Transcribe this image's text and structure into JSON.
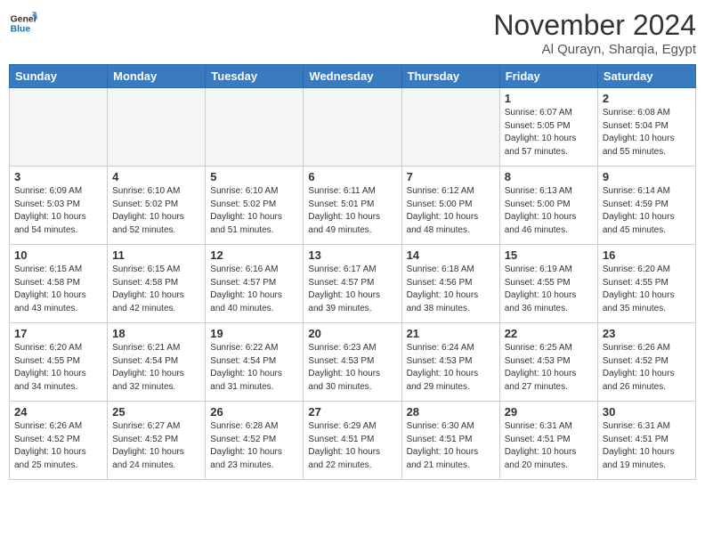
{
  "header": {
    "logo_line1": "General",
    "logo_line2": "Blue",
    "month": "November 2024",
    "location": "Al Qurayn, Sharqia, Egypt"
  },
  "weekdays": [
    "Sunday",
    "Monday",
    "Tuesday",
    "Wednesday",
    "Thursday",
    "Friday",
    "Saturday"
  ],
  "weeks": [
    [
      {
        "day": "",
        "info": ""
      },
      {
        "day": "",
        "info": ""
      },
      {
        "day": "",
        "info": ""
      },
      {
        "day": "",
        "info": ""
      },
      {
        "day": "",
        "info": ""
      },
      {
        "day": "1",
        "info": "Sunrise: 6:07 AM\nSunset: 5:05 PM\nDaylight: 10 hours and 57 minutes."
      },
      {
        "day": "2",
        "info": "Sunrise: 6:08 AM\nSunset: 5:04 PM\nDaylight: 10 hours and 55 minutes."
      }
    ],
    [
      {
        "day": "3",
        "info": "Sunrise: 6:09 AM\nSunset: 5:03 PM\nDaylight: 10 hours and 54 minutes."
      },
      {
        "day": "4",
        "info": "Sunrise: 6:10 AM\nSunset: 5:02 PM\nDaylight: 10 hours and 52 minutes."
      },
      {
        "day": "5",
        "info": "Sunrise: 6:10 AM\nSunset: 5:02 PM\nDaylight: 10 hours and 51 minutes."
      },
      {
        "day": "6",
        "info": "Sunrise: 6:11 AM\nSunset: 5:01 PM\nDaylight: 10 hours and 49 minutes."
      },
      {
        "day": "7",
        "info": "Sunrise: 6:12 AM\nSunset: 5:00 PM\nDaylight: 10 hours and 48 minutes."
      },
      {
        "day": "8",
        "info": "Sunrise: 6:13 AM\nSunset: 5:00 PM\nDaylight: 10 hours and 46 minutes."
      },
      {
        "day": "9",
        "info": "Sunrise: 6:14 AM\nSunset: 4:59 PM\nDaylight: 10 hours and 45 minutes."
      }
    ],
    [
      {
        "day": "10",
        "info": "Sunrise: 6:15 AM\nSunset: 4:58 PM\nDaylight: 10 hours and 43 minutes."
      },
      {
        "day": "11",
        "info": "Sunrise: 6:15 AM\nSunset: 4:58 PM\nDaylight: 10 hours and 42 minutes."
      },
      {
        "day": "12",
        "info": "Sunrise: 6:16 AM\nSunset: 4:57 PM\nDaylight: 10 hours and 40 minutes."
      },
      {
        "day": "13",
        "info": "Sunrise: 6:17 AM\nSunset: 4:57 PM\nDaylight: 10 hours and 39 minutes."
      },
      {
        "day": "14",
        "info": "Sunrise: 6:18 AM\nSunset: 4:56 PM\nDaylight: 10 hours and 38 minutes."
      },
      {
        "day": "15",
        "info": "Sunrise: 6:19 AM\nSunset: 4:55 PM\nDaylight: 10 hours and 36 minutes."
      },
      {
        "day": "16",
        "info": "Sunrise: 6:20 AM\nSunset: 4:55 PM\nDaylight: 10 hours and 35 minutes."
      }
    ],
    [
      {
        "day": "17",
        "info": "Sunrise: 6:20 AM\nSunset: 4:55 PM\nDaylight: 10 hours and 34 minutes."
      },
      {
        "day": "18",
        "info": "Sunrise: 6:21 AM\nSunset: 4:54 PM\nDaylight: 10 hours and 32 minutes."
      },
      {
        "day": "19",
        "info": "Sunrise: 6:22 AM\nSunset: 4:54 PM\nDaylight: 10 hours and 31 minutes."
      },
      {
        "day": "20",
        "info": "Sunrise: 6:23 AM\nSunset: 4:53 PM\nDaylight: 10 hours and 30 minutes."
      },
      {
        "day": "21",
        "info": "Sunrise: 6:24 AM\nSunset: 4:53 PM\nDaylight: 10 hours and 29 minutes."
      },
      {
        "day": "22",
        "info": "Sunrise: 6:25 AM\nSunset: 4:53 PM\nDaylight: 10 hours and 27 minutes."
      },
      {
        "day": "23",
        "info": "Sunrise: 6:26 AM\nSunset: 4:52 PM\nDaylight: 10 hours and 26 minutes."
      }
    ],
    [
      {
        "day": "24",
        "info": "Sunrise: 6:26 AM\nSunset: 4:52 PM\nDaylight: 10 hours and 25 minutes."
      },
      {
        "day": "25",
        "info": "Sunrise: 6:27 AM\nSunset: 4:52 PM\nDaylight: 10 hours and 24 minutes."
      },
      {
        "day": "26",
        "info": "Sunrise: 6:28 AM\nSunset: 4:52 PM\nDaylight: 10 hours and 23 minutes."
      },
      {
        "day": "27",
        "info": "Sunrise: 6:29 AM\nSunset: 4:51 PM\nDaylight: 10 hours and 22 minutes."
      },
      {
        "day": "28",
        "info": "Sunrise: 6:30 AM\nSunset: 4:51 PM\nDaylight: 10 hours and 21 minutes."
      },
      {
        "day": "29",
        "info": "Sunrise: 6:31 AM\nSunset: 4:51 PM\nDaylight: 10 hours and 20 minutes."
      },
      {
        "day": "30",
        "info": "Sunrise: 6:31 AM\nSunset: 4:51 PM\nDaylight: 10 hours and 19 minutes."
      }
    ]
  ]
}
